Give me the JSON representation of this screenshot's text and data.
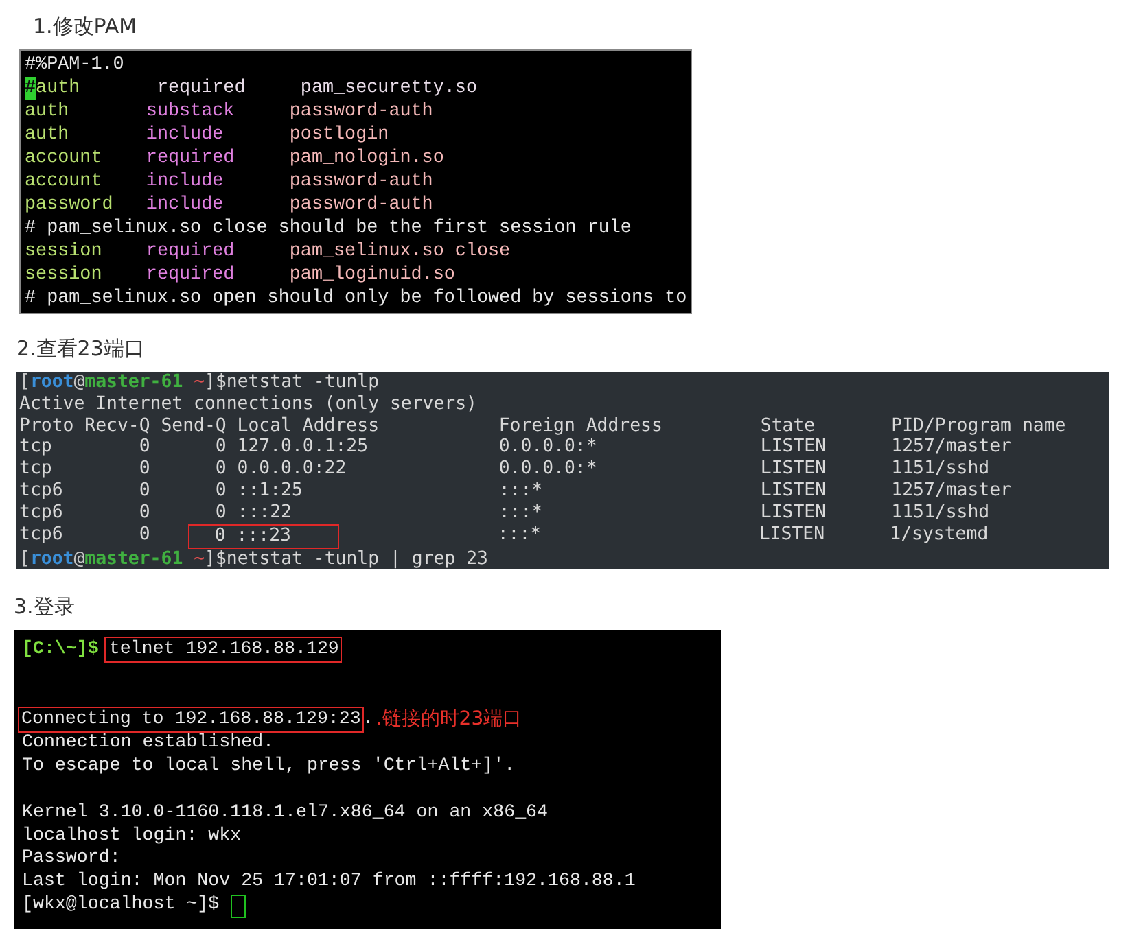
{
  "sections": [
    {
      "heading": "1.修改PAM",
      "terminal": {
        "kind": "vim",
        "lines": [
          {
            "segments": [
              {
                "text": "#%PAM-1.0",
                "color": "#e8e8e8"
              }
            ]
          },
          {
            "segments": [
              {
                "text": "#",
                "color": "#30d030",
                "kind": "cursor"
              },
              {
                "text": "auth       ",
                "color": "#b8e070"
              },
              {
                "text": "required     ",
                "color": "#e8dce8"
              },
              {
                "text": "pam_securetty.so",
                "color": "#e8dce8"
              }
            ]
          },
          {
            "segments": [
              {
                "text": "auth       ",
                "color": "#b8e070"
              },
              {
                "text": "substack     ",
                "color": "#e080e0"
              },
              {
                "text": "password-auth",
                "color": "#f4b8b8"
              }
            ]
          },
          {
            "segments": [
              {
                "text": "auth       ",
                "color": "#b8e070"
              },
              {
                "text": "include      ",
                "color": "#e080e0"
              },
              {
                "text": "postlogin",
                "color": "#f4b8b8"
              }
            ]
          },
          {
            "segments": [
              {
                "text": "account    ",
                "color": "#b8e070"
              },
              {
                "text": "required     ",
                "color": "#e080e0"
              },
              {
                "text": "pam_nologin.so",
                "color": "#f4b8b8"
              }
            ]
          },
          {
            "segments": [
              {
                "text": "account    ",
                "color": "#b8e070"
              },
              {
                "text": "include      ",
                "color": "#e080e0"
              },
              {
                "text": "password-auth",
                "color": "#f4b8b8"
              }
            ]
          },
          {
            "segments": [
              {
                "text": "password   ",
                "color": "#b8e070"
              },
              {
                "text": "include      ",
                "color": "#e080e0"
              },
              {
                "text": "password-auth",
                "color": "#f4b8b8"
              }
            ]
          },
          {
            "segments": [
              {
                "text": "# pam_selinux.so close should be the first session rule",
                "color": "#e8e8e8"
              }
            ]
          },
          {
            "segments": [
              {
                "text": "session    ",
                "color": "#b8e070"
              },
              {
                "text": "required     ",
                "color": "#e080e0"
              },
              {
                "text": "pam_selinux.so close",
                "color": "#f4b8b8"
              }
            ]
          },
          {
            "segments": [
              {
                "text": "session    ",
                "color": "#b8e070"
              },
              {
                "text": "required     ",
                "color": "#e080e0"
              },
              {
                "text": "pam_loginuid.so",
                "color": "#f4b8b8"
              }
            ]
          },
          {
            "segments": [
              {
                "text": "# pam_selinux.so open should only be followed by sessions to",
                "color": "#e8e8e8"
              }
            ]
          }
        ]
      }
    },
    {
      "heading": "2.查看23端口",
      "terminal": {
        "kind": "shell",
        "lines": [
          {
            "segments": [
              {
                "text": "[",
                "color": "#c8c8c8"
              },
              {
                "text": "root",
                "color": "#3a8fd8",
                "kind": "bold"
              },
              {
                "text": "@",
                "color": "#c8c8c8"
              },
              {
                "text": "master-61",
                "color": "#40b040",
                "kind": "bold"
              },
              {
                "text": " ~",
                "color": "#e05050"
              },
              {
                "text": "]$netstat -tunlp",
                "color": "#d8d8d8"
              }
            ]
          },
          {
            "segments": [
              {
                "text": "Active Internet connections (only servers)",
                "color": "#d8d8d8"
              }
            ]
          },
          {
            "segments": [
              {
                "text": "Proto Recv-Q Send-Q Local Address           Foreign Address         State       PID/Program name",
                "color": "#d8d8d8"
              }
            ]
          },
          {
            "segments": [
              {
                "text": "tcp        0      0 127.0.0.1:25            0.0.0.0:*               LISTEN      1257/master",
                "color": "#d8d8d8"
              }
            ]
          },
          {
            "segments": [
              {
                "text": "tcp        0      0 0.0.0.0:22              0.0.0.0:*               LISTEN      1151/sshd",
                "color": "#d8d8d8"
              }
            ]
          },
          {
            "segments": [
              {
                "text": "tcp6       0      0 ::1:25                  :::*                    LISTEN      1257/master",
                "color": "#d8d8d8"
              }
            ]
          },
          {
            "segments": [
              {
                "text": "tcp6       0      0 :::22                   :::*                    LISTEN      1151/sshd",
                "color": "#d8d8d8"
              }
            ]
          },
          {
            "segments": [
              {
                "text": "tcp6       0      ",
                "color": "#d8d8d8"
              },
              {
                "text": "0 :::23",
                "color": "#d8d8d8",
                "kind": "box"
              },
              {
                "text": "                   :::*                    LISTEN      1/systemd",
                "color": "#d8d8d8"
              }
            ]
          },
          {
            "segments": [
              {
                "text": "[",
                "color": "#c8c8c8"
              },
              {
                "text": "root",
                "color": "#3a8fd8",
                "kind": "bold"
              },
              {
                "text": "@",
                "color": "#c8c8c8"
              },
              {
                "text": "master-61",
                "color": "#40b040",
                "kind": "bold"
              },
              {
                "text": " ~",
                "color": "#e05050"
              },
              {
                "text": "]$netstat -tunlp | grep 23",
                "color": "#d8d8d8"
              }
            ]
          }
        ]
      }
    },
    {
      "heading": "3.登录",
      "terminal": {
        "kind": "console",
        "lines": [
          {
            "segments": [
              {
                "text": "[C:\\~]$ ",
                "color": "#80e040",
                "kind": "bold"
              },
              {
                "text": "telnet 192.168.88.129",
                "color": "#e8e8e8",
                "kind": "box"
              }
            ]
          },
          {
            "kind": "blank"
          },
          {
            "kind": "blank"
          },
          {
            "segments": [
              {
                "text": "Connecting to 192.168.88.129:23",
                "color": "#e8e8e8",
                "kind": "box"
              },
              {
                "text": ".",
                "color": "#e8e8e8"
              },
              {
                "text": ".链接的时23端口",
                "color": "#e8302a",
                "kind": "note"
              }
            ]
          },
          {
            "segments": [
              {
                "text": "Connection established.",
                "color": "#e8e8e8"
              }
            ]
          },
          {
            "segments": [
              {
                "text": "To escape to local shell, press 'Ctrl+Alt+]'.",
                "color": "#e8e8e8"
              }
            ]
          },
          {
            "kind": "blank"
          },
          {
            "segments": [
              {
                "text": "Kernel 3.10.0-1160.118.1.el7.x86_64 on an x86_64",
                "color": "#e8e8e8"
              }
            ]
          },
          {
            "segments": [
              {
                "text": "localhost login: wkx",
                "color": "#e8e8e8"
              }
            ]
          },
          {
            "segments": [
              {
                "text": "Password:",
                "color": "#e8e8e8"
              }
            ]
          },
          {
            "segments": [
              {
                "text": "Last login: Mon Nov 25 17:01:07 from ::ffff:192.168.88.1",
                "color": "#e8e8e8"
              }
            ]
          },
          {
            "segments": [
              {
                "text": "[wkx@localhost ~]$ ",
                "color": "#e8e8e8"
              },
              {
                "color": "#20c020",
                "kind": "cursor_box"
              }
            ]
          }
        ]
      }
    }
  ]
}
